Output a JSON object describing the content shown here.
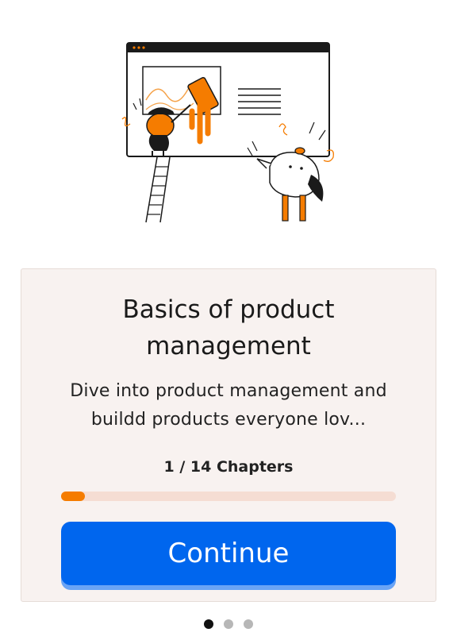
{
  "card": {
    "title": "Basics of product management",
    "description": "Dive into product management and buildd products everyone lov...",
    "chapters_text": "1 / 14 Chapters",
    "progress_fraction": 0.07,
    "continue_label": "Continue"
  },
  "pagination": {
    "total": 3,
    "active_index": 0
  },
  "colors": {
    "accent_orange": "#f57c00",
    "button_blue": "#0066ee",
    "card_background": "#f8f2f0",
    "progress_track": "#f5ddd3"
  }
}
